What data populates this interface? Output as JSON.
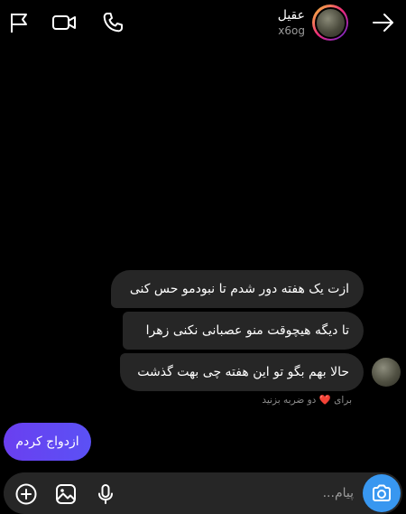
{
  "header": {
    "contact_name": "عقیل",
    "contact_username": "x6og"
  },
  "messages": [
    {
      "text": "ازت یک هفته دور شدم تا نبودمو حس کنی"
    },
    {
      "text": "تا دیگه هیچوقت منو عصبانی نکنی زهرا"
    },
    {
      "text": "حالا بهم بگو تو این هفته چی بهت گذشت"
    }
  ],
  "reaction_hint": {
    "before": "برای",
    "heart": "❤️",
    "after": "دو ضربه بزنید"
  },
  "my_message": {
    "text": "ازدواج کردم"
  },
  "composer": {
    "placeholder": "پیام..."
  },
  "icons": {
    "flag": "flag-icon",
    "video": "video-camera-icon",
    "phone": "phone-icon",
    "back": "arrow-right-icon",
    "add": "plus-circle-icon",
    "gallery": "image-icon",
    "mic": "microphone-icon",
    "camera": "camera-icon"
  },
  "colors": {
    "background": "#000000",
    "bubble_incoming": "#262626",
    "bubble_outgoing": "#6a3ff0",
    "camera_button": "#3897f0",
    "heart": "#ed2b3a"
  }
}
